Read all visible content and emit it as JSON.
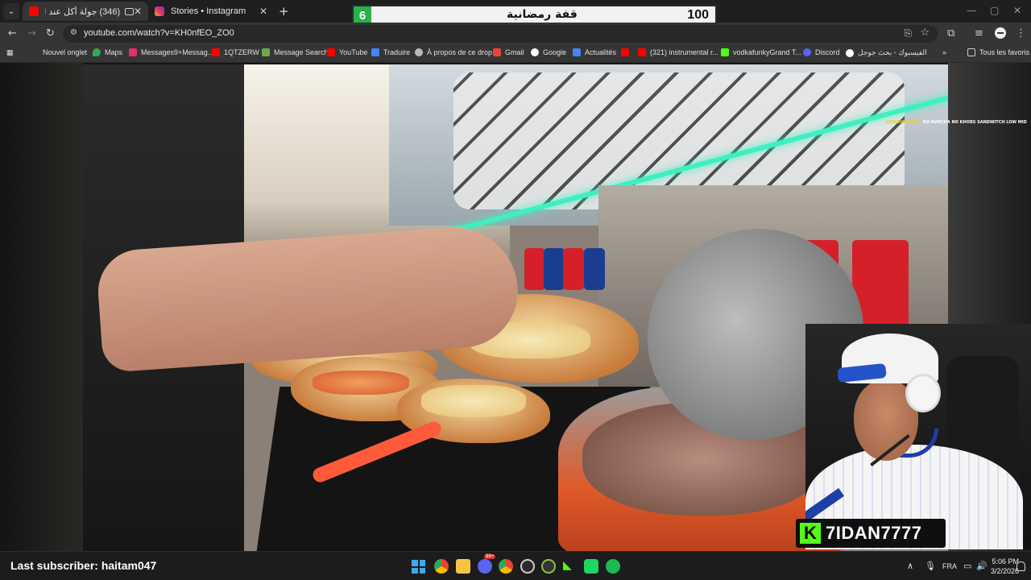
{
  "browser": {
    "tabs": [
      {
        "label": "(346) جولة أكل عند احسن ب...",
        "active": true
      },
      {
        "label": "Stories • Instagram",
        "active": false
      }
    ],
    "url": "youtube.com/watch?v=KH0nfEO_ZO0",
    "bookmarks": [
      "Nouvel onglet",
      "Maps",
      "Messages9+Messag...",
      "1QTZERW",
      "Message Search",
      "YouTube",
      "Traduire",
      "À propos de ce drop",
      "Gmail",
      "Google",
      "Actualités",
      "",
      "(321) instrumental r...",
      "vodkafunkyGrand T...",
      "Discord",
      "الفيسبوك - بحث جوجل"
    ],
    "all_bookmarks": "Tous les favoris"
  },
  "overlay": {
    "rank": "6",
    "title": "قفة رمضانية",
    "points": "100"
  },
  "video": {
    "caption_yellow": "@JOURNALISTE",
    "caption_white": "NO MAECHA NO KHOBS SANDWITCH LOW MID"
  },
  "stream": {
    "kick_name": "7IDAN7777",
    "last_subscriber": "Last subscriber: haitam047"
  },
  "taskbar": {
    "lang": "FRA",
    "time": "5:06 PM",
    "date": "3/2/2026",
    "chat_badge": "99+"
  },
  "colors": {
    "kick_green": "#53fc18",
    "rank_green": "#27b24a",
    "neon": "#3ef0c0"
  }
}
